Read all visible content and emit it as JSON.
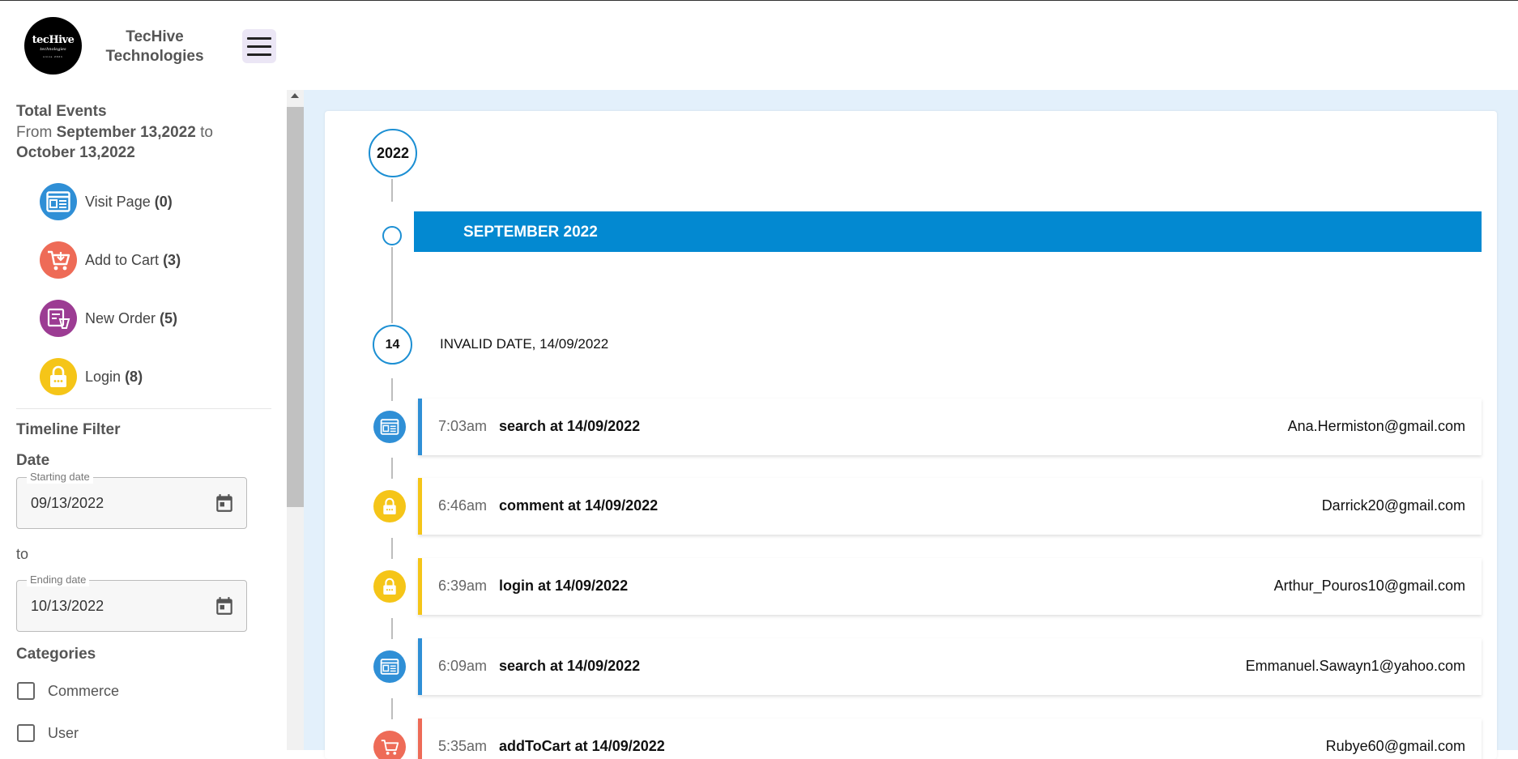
{
  "brand": {
    "logo_line1": "tecHive",
    "logo_line2": "technologies",
    "logo_line3": "since 2021",
    "name_line1": "TecHive",
    "name_line2": "Technologies"
  },
  "sidebar": {
    "total_events_title": "Total Events",
    "range_prefix": "From",
    "range_start": "September 13,2022",
    "range_mid": "to",
    "range_end": "October 13,2022",
    "event_types": [
      {
        "label": "Visit Page",
        "count": "(0)",
        "icon": "visit-page-icon",
        "color": "#2f8fd6"
      },
      {
        "label": "Add to Cart",
        "count": "(3)",
        "icon": "add-to-cart-icon",
        "color": "#ee6b57"
      },
      {
        "label": "New Order",
        "count": "(5)",
        "icon": "new-order-icon",
        "color": "#9c3c93"
      },
      {
        "label": "Login",
        "count": "(8)",
        "icon": "lock-icon",
        "color": "#f5c518"
      }
    ],
    "timeline_filter_title": "Timeline Filter",
    "date_title": "Date",
    "start_date_label": "Starting date",
    "start_date_value": "09/13/2022",
    "to_label": "to",
    "end_date_label": "Ending date",
    "end_date_value": "10/13/2022",
    "categories_title": "Categories",
    "categories": [
      "Commerce",
      "User"
    ]
  },
  "timeline": {
    "year": "2022",
    "month": "SEPTEMBER 2022",
    "day": "14",
    "day_label": "INVALID DATE, 14/09/2022",
    "events": [
      {
        "time": "7:03am",
        "title": "search at 14/09/2022",
        "email": "Ana.Hermiston@gmail.com",
        "icon": "visit-page-icon",
        "color": "#2f8fd6"
      },
      {
        "time": "6:46am",
        "title": "comment at 14/09/2022",
        "email": "Darrick20@gmail.com",
        "icon": "lock-icon",
        "color": "#f5c518"
      },
      {
        "time": "6:39am",
        "title": "login at 14/09/2022",
        "email": "Arthur_Pouros10@gmail.com",
        "icon": "lock-icon",
        "color": "#f5c518"
      },
      {
        "time": "6:09am",
        "title": "search at 14/09/2022",
        "email": "Emmanuel.Sawayn1@yahoo.com",
        "icon": "visit-page-icon",
        "color": "#2f8fd6"
      },
      {
        "time": "5:35am",
        "title": "addToCart at 14/09/2022",
        "email": "Rubye60@gmail.com",
        "icon": "add-to-cart-icon",
        "color": "#ee6b57"
      }
    ]
  },
  "colors": {
    "accent": "#0389d1",
    "main_bg": "#e3f0fb"
  }
}
